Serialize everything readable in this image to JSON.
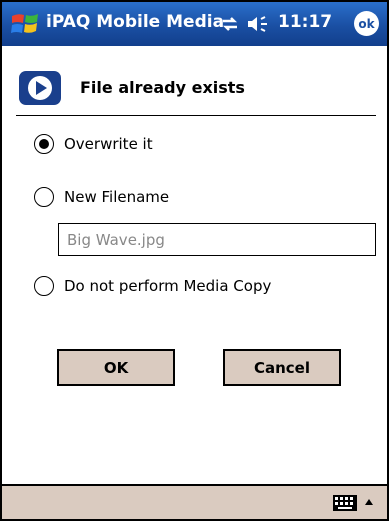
{
  "titlebar": {
    "app_title": "iPAQ Mobile Media",
    "time": "11:17",
    "ok_label": "ok",
    "icons": [
      "windows-start-icon",
      "connectivity-icon",
      "volume-icon"
    ]
  },
  "dialog": {
    "heading": "File already exists",
    "options": [
      {
        "label": "Overwrite it",
        "selected": true
      },
      {
        "label": "New Filename",
        "selected": false
      },
      {
        "label": "Do not perform Media Copy",
        "selected": false
      }
    ],
    "filename_value": "Big Wave.jpg",
    "ok_button": "OK",
    "cancel_button": "Cancel"
  },
  "bottom_bar": {
    "icons": [
      "keyboard-icon",
      "input-panel-arrow-icon"
    ]
  },
  "colors": {
    "titlebar": "#1a4fa3",
    "button_face": "#dacbc0",
    "frame": "#000000"
  }
}
